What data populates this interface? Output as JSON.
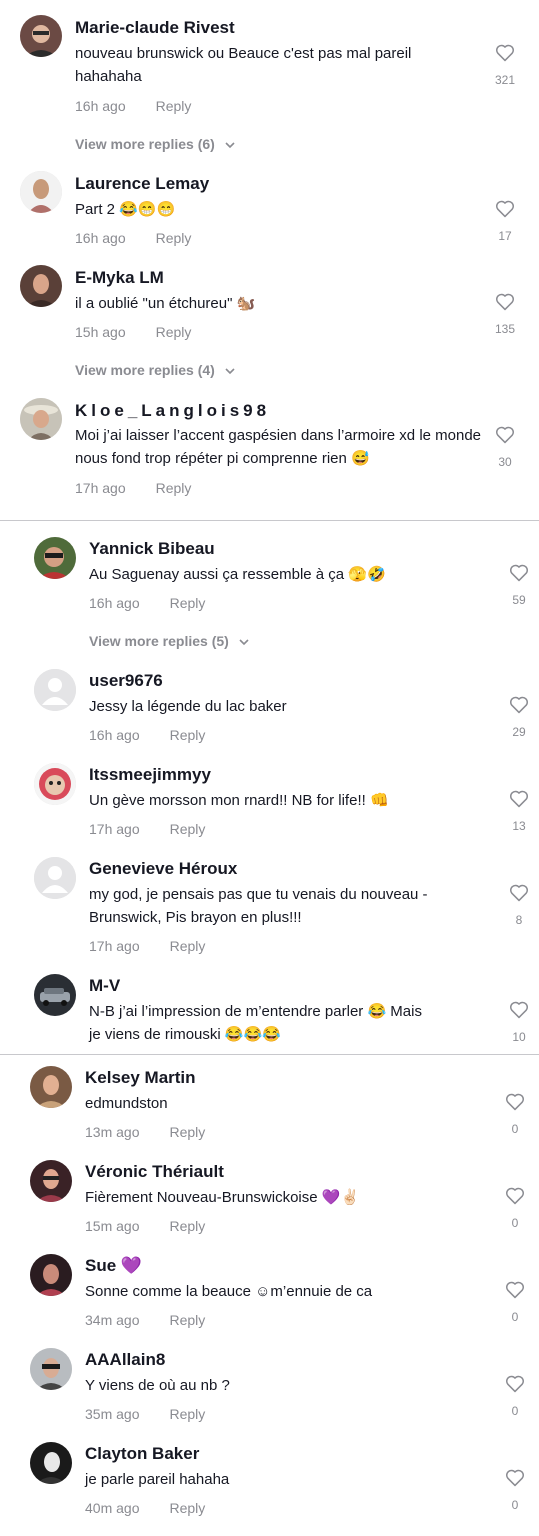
{
  "comments": [
    {
      "user": "Marie-claude Rivest",
      "text": "nouveau brunswick ou Beauce c'est pas mal pareil hahahaha",
      "time": "16h ago",
      "reply": "Reply",
      "likes": "321",
      "view_more": "View more replies (6)"
    },
    {
      "user": "Laurence Lemay",
      "text": "Part 2 😂😁😁",
      "time": "16h ago",
      "reply": "Reply",
      "likes": "17"
    },
    {
      "user": "E-Myka LM",
      "text": "il a oublié \"un étchureu\" 🐿️",
      "time": "15h ago",
      "reply": "Reply",
      "likes": "135",
      "view_more": "View more replies (4)"
    },
    {
      "user": "Kloe_Langlois98",
      "text": "Moi j’ai laisser l’accent gaspésien dans l’armoire xd le monde nous fond trop répéter pi comprenne rien 😅",
      "time": "17h ago",
      "reply": "Reply",
      "likes": "30"
    },
    {
      "user": "Yannick Bibeau",
      "text": "Au Saguenay aussi ça ressemble à ça 🫣🤣",
      "time": "16h ago",
      "reply": "Reply",
      "likes": "59",
      "view_more": "View more replies (5)"
    },
    {
      "user": "user9676",
      "text": "Jessy la légende du lac baker",
      "time": "16h ago",
      "reply": "Reply",
      "likes": "29"
    },
    {
      "user": "Itssmeejimmyy",
      "text": "Un gève morsson mon rnard!! NB for life!! 👊",
      "time": "17h ago",
      "reply": "Reply",
      "likes": "13"
    },
    {
      "user": "Genevieve Héroux",
      "text": "my god, je pensais pas que tu venais du nouveau -Brunswick, Pis brayon en plus!!!",
      "time": "17h ago",
      "reply": "Reply",
      "likes": "8"
    },
    {
      "user": "M-V",
      "text": "N-B j’ai l’impression de m’entendre parler 😂 Mais je viens de rimouski 😂😂😂",
      "likes": "10"
    },
    {
      "user": "Kelsey Martin",
      "text": "edmundston",
      "time": "13m ago",
      "reply": "Reply",
      "likes": "0"
    },
    {
      "user": "Véronic Thériault",
      "text": "Fièrement Nouveau-Brunswickoise 💜✌🏻",
      "time": "15m ago",
      "reply": "Reply",
      "likes": "0"
    },
    {
      "user": "Sue 💜",
      "text": "Sonne comme la beauce ☺m’ennuie de ca",
      "time": "34m ago",
      "reply": "Reply",
      "likes": "0"
    },
    {
      "user": "AAAllain8",
      "text": "Y viens de où au nb ?",
      "time": "35m ago",
      "reply": "Reply",
      "likes": "0"
    },
    {
      "user": "Clayton Baker",
      "text": "je parle pareil hahaha",
      "time": "40m ago",
      "reply": "Reply",
      "likes": "0"
    }
  ],
  "icons": {
    "like": "heart-outline-icon",
    "expand": "chevron-down-icon",
    "avatar": "user-avatar"
  },
  "colors": {
    "text": "#161823",
    "muted": "#8a8b91",
    "divider": "#c8c8cc"
  }
}
